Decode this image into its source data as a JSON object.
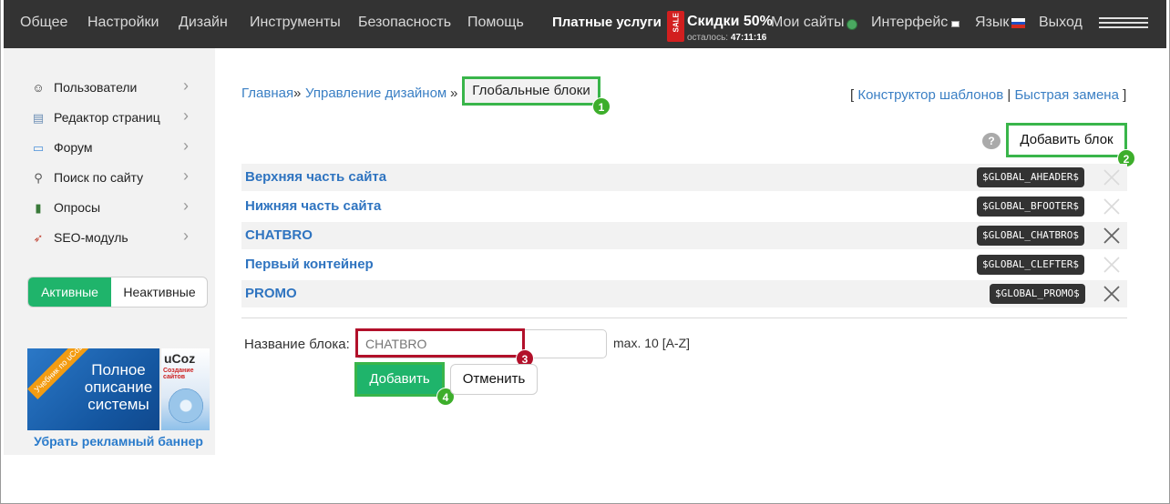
{
  "topnav": {
    "items": [
      "Общее",
      "Настройки",
      "Дизайн",
      "Инструменты",
      "Безопасность",
      "Помощь"
    ],
    "paid_services": "Платные услуги",
    "sale": {
      "tag": "SALE",
      "title": "Скидки 50%",
      "remaining_label": "осталось:",
      "remaining_time": "47:11:16"
    },
    "my_sites": "Мои сайты",
    "interface": "Интерфейс",
    "language": "Язык",
    "logout": "Выход"
  },
  "sidebar": {
    "items": [
      {
        "label": "Пользователи",
        "icon": "user-icon"
      },
      {
        "label": "Редактор страниц",
        "icon": "page-icon"
      },
      {
        "label": "Форум",
        "icon": "chat-icon"
      },
      {
        "label": "Поиск по сайту",
        "icon": "search-icon"
      },
      {
        "label": "Опросы",
        "icon": "chart-icon"
      },
      {
        "label": "SEO-модуль",
        "icon": "rocket-icon"
      }
    ],
    "toggle": {
      "active": "Активные",
      "inactive": "Неактивные"
    },
    "banner": {
      "ribbon": "Учебник по uCoz",
      "headline": "Полное описание системы",
      "logo": "uCoz",
      "sub": "Создание сайтов"
    },
    "remove_banner": "Убрать рекламный баннер"
  },
  "breadcrumb": {
    "home": "Главная",
    "design": "Управление дизайном",
    "separator": "»",
    "current": "Глобальные блоки"
  },
  "toplinks": {
    "open": "[",
    "templates": "Конструктор шаблонов",
    "divider": "|",
    "replace": "Быстрая замена",
    "close": "]"
  },
  "help_icon": "?",
  "add_block_label": "Добавить блок",
  "blocks": [
    {
      "name": "Верхняя часть сайта",
      "code": "$GLOBAL_AHEADER$",
      "deletable": false
    },
    {
      "name": "Нижняя часть сайта",
      "code": "$GLOBAL_BFOOTER$",
      "deletable": false
    },
    {
      "name": "CHATBRO",
      "code": "$GLOBAL_CHATBRO$",
      "deletable": true
    },
    {
      "name": "Первый контейнер",
      "code": "$GLOBAL_CLEFTER$",
      "deletable": false
    },
    {
      "name": "PROMO",
      "code": "$GLOBAL_PROMO$",
      "deletable": true
    }
  ],
  "form": {
    "label": "Название блока:",
    "value": "",
    "placeholder": "CHATBRO",
    "hint": "max. 10 [A-Z]",
    "submit": "Добавить",
    "cancel": "Отменить"
  },
  "badges": [
    "1",
    "2",
    "3",
    "4"
  ],
  "colors": {
    "topbar": "#333333",
    "accent_green": "#1fb46b",
    "highlight_green": "#39b54a",
    "highlight_red": "#b2102a",
    "link": "#3a7fc4"
  }
}
